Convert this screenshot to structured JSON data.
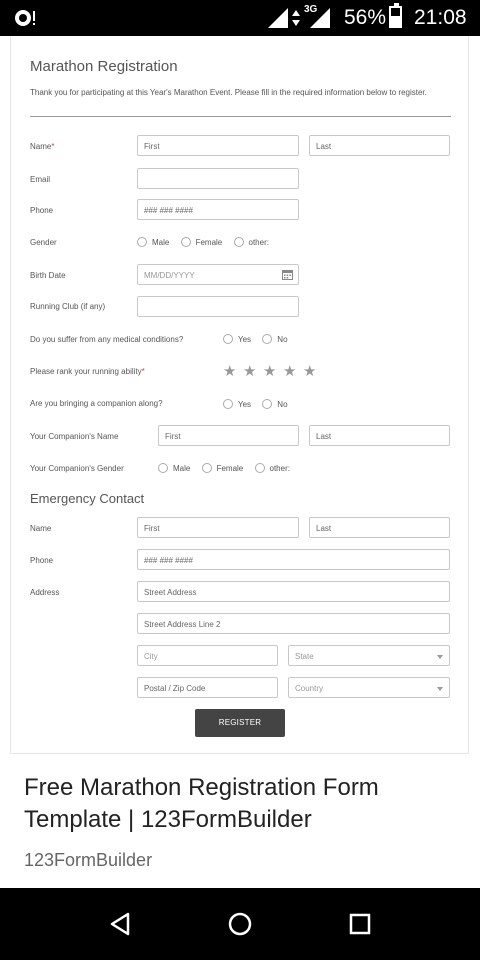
{
  "status_bar": {
    "network": "3G",
    "battery_percent": "56%",
    "time": "21:08",
    "battery_level": 0.56
  },
  "form": {
    "title": "Marathon Registration",
    "intro": "Thank you for participating at this Year's Marathon Event. Please fill in the required information below to register.",
    "name": {
      "label": "Name",
      "required_mark": "*",
      "first_placeholder": "First",
      "last_placeholder": "Last"
    },
    "email": {
      "label": "Email"
    },
    "phone": {
      "label": "Phone",
      "placeholder": "### ### ####"
    },
    "gender": {
      "label": "Gender",
      "options": [
        "Male",
        "Female",
        "other:"
      ]
    },
    "birth_date": {
      "label": "Birth Date",
      "placeholder": "MM/DD/YYYY"
    },
    "running_club": {
      "label": "Running Club (if any)"
    },
    "medical": {
      "label": "Do you suffer from any medical conditions?",
      "options": [
        "Yes",
        "No"
      ]
    },
    "rank": {
      "label": "Please rank your running ability",
      "required_mark": "*",
      "stars": 5,
      "rating": 0
    },
    "companion_q": {
      "label": "Are you bringing a companion along?",
      "options": [
        "Yes",
        "No"
      ]
    },
    "companion_name": {
      "label": "Your Companion's Name",
      "first_placeholder": "First",
      "last_placeholder": "Last"
    },
    "companion_gender": {
      "label": "Your Companion's Gender",
      "options": [
        "Male",
        "Female",
        "other:"
      ]
    },
    "emergency": {
      "title": "Emergency Contact",
      "name": {
        "label": "Name",
        "first_placeholder": "First",
        "last_placeholder": "Last"
      },
      "phone": {
        "label": "Phone",
        "placeholder": "### ### ####"
      },
      "address": {
        "label": "Address",
        "street_placeholder": "Street Address",
        "street2_placeholder": "Street Address Line 2",
        "city_placeholder": "City",
        "state_placeholder": "State",
        "zip_placeholder": "Postal / Zip Code",
        "country_placeholder": "Country"
      }
    },
    "register_label": "REGISTER"
  },
  "result": {
    "title": "Free Marathon Registration Form Template | 123FormBuilder",
    "source": "123FormBuilder"
  },
  "nav": {
    "icons": [
      "back-icon",
      "home-icon",
      "recents-icon"
    ]
  }
}
